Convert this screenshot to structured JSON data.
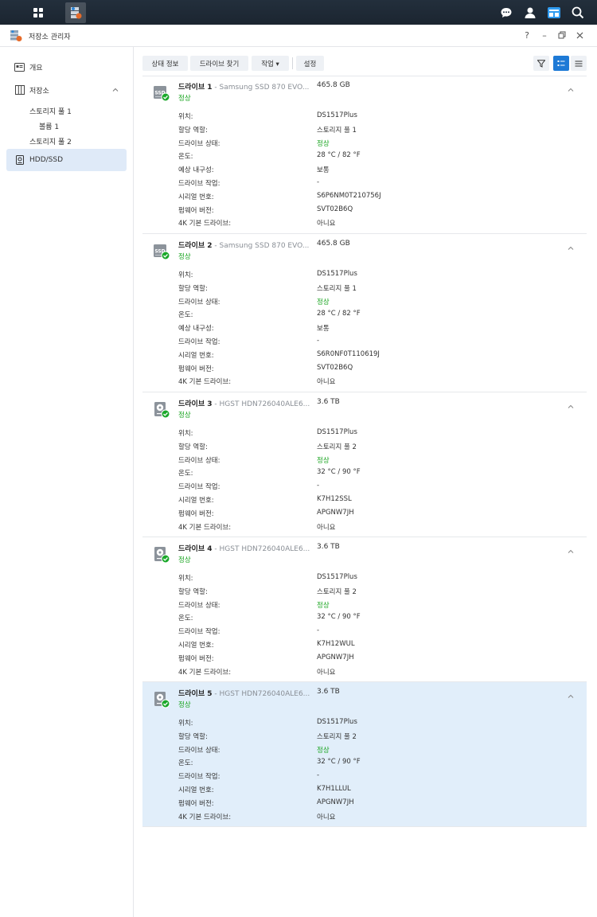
{
  "app": {
    "title": "저장소 관리자",
    "help": "?",
    "minimize": "–"
  },
  "colors": {
    "accent": "#1e7ad6",
    "ok": "#15a31c",
    "selected": "#e1eefa"
  },
  "sidebar": {
    "overview": "개요",
    "storage": "저장소",
    "pool1": "스토리지 풀 1",
    "volume1": "볼륨 1",
    "pool2": "스토리지 풀 2",
    "hddssd": "HDD/SSD"
  },
  "toolbar": {
    "status_info": "상태 정보",
    "find_drive": "드라이브 찾기",
    "action": "작업 ▾",
    "settings": "설정"
  },
  "drives": [
    {
      "name": "드라이브 1",
      "model": " - Samsung SSD 870 EVO...",
      "size": "465.8 GB",
      "status": "정상",
      "icon": "ssd-icon",
      "props": [
        {
          "label": "위치:",
          "value": "DS1517Plus"
        },
        {
          "label": "할당 역할:",
          "value": "스토리지 풀 1"
        },
        {
          "label": "드라이브 상태:",
          "value": "정상"
        },
        {
          "label": "온도:",
          "value": "28 °C / 82 °F"
        },
        {
          "label": "예상 내구성:",
          "value": "보통"
        },
        {
          "label": "드라이브 작업:",
          "value": "-"
        },
        {
          "label": "시리얼 번호:",
          "value": "S6P6NM0T210756J"
        },
        {
          "label": "펌웨어 버전:",
          "value": "SVT02B6Q"
        },
        {
          "label": "4K 기본 드라이브:",
          "value": "아니요"
        }
      ]
    },
    {
      "name": "드라이브 2",
      "model": " - Samsung SSD 870 EVO...",
      "size": "465.8 GB",
      "status": "정상",
      "icon": "ssd-icon",
      "props": [
        {
          "label": "위치:",
          "value": "DS1517Plus"
        },
        {
          "label": "할당 역할:",
          "value": "스토리지 풀 1"
        },
        {
          "label": "드라이브 상태:",
          "value": "정상"
        },
        {
          "label": "온도:",
          "value": "28 °C / 82 °F"
        },
        {
          "label": "예상 내구성:",
          "value": "보통"
        },
        {
          "label": "드라이브 작업:",
          "value": "-"
        },
        {
          "label": "시리얼 번호:",
          "value": "S6R0NF0T110619J"
        },
        {
          "label": "펌웨어 버전:",
          "value": "SVT02B6Q"
        },
        {
          "label": "4K 기본 드라이브:",
          "value": "아니요"
        }
      ]
    },
    {
      "name": "드라이브 3",
      "model": " - HGST HDN726040ALE6...",
      "size": "3.6 TB",
      "status": "정상",
      "icon": "hdd-icon",
      "props": [
        {
          "label": "위치:",
          "value": "DS1517Plus"
        },
        {
          "label": "할당 역할:",
          "value": "스토리지 풀 2"
        },
        {
          "label": "드라이브 상태:",
          "value": "정상"
        },
        {
          "label": "온도:",
          "value": "32 °C / 90 °F"
        },
        {
          "label": "드라이브 작업:",
          "value": "-"
        },
        {
          "label": "시리얼 번호:",
          "value": "K7H12SSL"
        },
        {
          "label": "펌웨어 버전:",
          "value": "APGNW7JH"
        },
        {
          "label": "4K 기본 드라이브:",
          "value": "아니요"
        }
      ]
    },
    {
      "name": "드라이브 4",
      "model": " - HGST HDN726040ALE6...",
      "size": "3.6 TB",
      "status": "정상",
      "icon": "hdd-icon",
      "props": [
        {
          "label": "위치:",
          "value": "DS1517Plus"
        },
        {
          "label": "할당 역할:",
          "value": "스토리지 풀 2"
        },
        {
          "label": "드라이브 상태:",
          "value": "정상"
        },
        {
          "label": "온도:",
          "value": "32 °C / 90 °F"
        },
        {
          "label": "드라이브 작업:",
          "value": "-"
        },
        {
          "label": "시리얼 번호:",
          "value": "K7H12WUL"
        },
        {
          "label": "펌웨어 버전:",
          "value": "APGNW7JH"
        },
        {
          "label": "4K 기본 드라이브:",
          "value": "아니요"
        }
      ]
    },
    {
      "name": "드라이브 5",
      "model": " - HGST HDN726040ALE6...",
      "size": "3.6 TB",
      "status": "정상",
      "icon": "hdd-icon",
      "selected": true,
      "props": [
        {
          "label": "위치:",
          "value": "DS1517Plus"
        },
        {
          "label": "할당 역할:",
          "value": "스토리지 풀 2"
        },
        {
          "label": "드라이브 상태:",
          "value": "정상"
        },
        {
          "label": "온도:",
          "value": "32 °C / 90 °F"
        },
        {
          "label": "드라이브 작업:",
          "value": "-"
        },
        {
          "label": "시리얼 번호:",
          "value": "K7H1LLUL"
        },
        {
          "label": "펌웨어 버전:",
          "value": "APGNW7JH"
        },
        {
          "label": "4K 기본 드라이브:",
          "value": "아니요"
        }
      ]
    }
  ]
}
